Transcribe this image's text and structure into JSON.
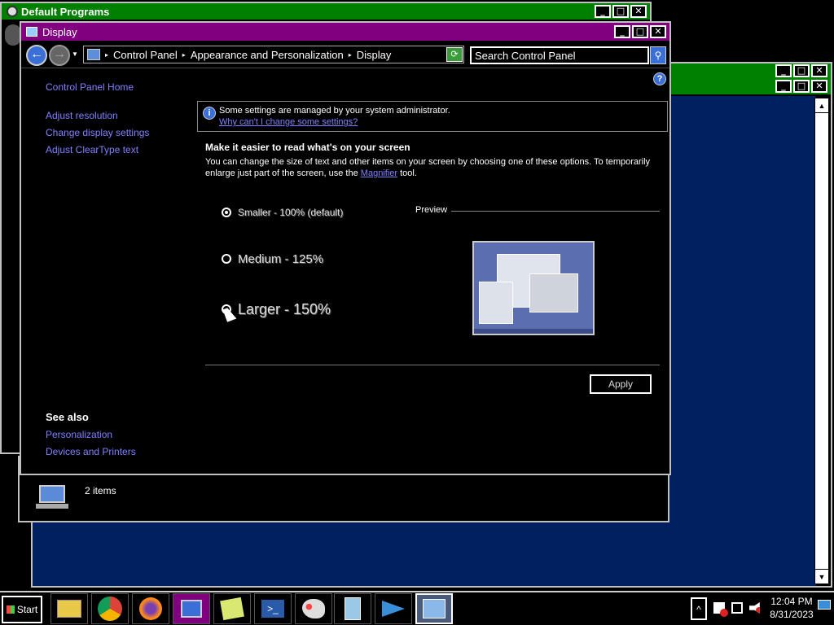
{
  "desktop": {
    "bg": "#000000"
  },
  "back_window_default_programs": {
    "title": "Default Programs"
  },
  "display_window": {
    "title": "Display",
    "breadcrumb": [
      "Control Panel",
      "Appearance and Personalization",
      "Display"
    ],
    "search": {
      "placeholder": "Search Control Panel",
      "value": "Search Control Panel"
    },
    "sidebar": {
      "home": "Control Panel Home",
      "links": [
        "Adjust resolution",
        "Change display settings",
        "Adjust ClearType text"
      ],
      "see_also_title": "See also",
      "see_also_links": [
        "Personalization",
        "Devices and Printers"
      ]
    },
    "notice": {
      "text": "Some settings are managed by your system administrator.",
      "link": "Why can't I change some settings?"
    },
    "heading": "Make it easier to read what's on your screen",
    "description_part1": "You can change the size of text and other items on your screen by choosing one of these options. To temporarily enlarge just part of the screen, use the",
    "magnifier_link": "Magnifier",
    "description_part2": "tool.",
    "options": [
      {
        "label": "Smaller - 100% (default)",
        "selected": true
      },
      {
        "label": "Medium - 125%",
        "selected": false
      },
      {
        "label": "Larger - 150%",
        "selected": false
      }
    ],
    "preview_label": "Preview",
    "apply_label": "Apply"
  },
  "explorer_status": {
    "items": "2 items"
  },
  "taskbar": {
    "start_label": "Start",
    "clock_time": "12:04 PM",
    "clock_date": "8/31/2023",
    "tray_chevron": "^"
  },
  "colors": {
    "title_green": "#008000",
    "title_purple": "#800080",
    "link": "#8080ff",
    "navy": "#002060"
  }
}
